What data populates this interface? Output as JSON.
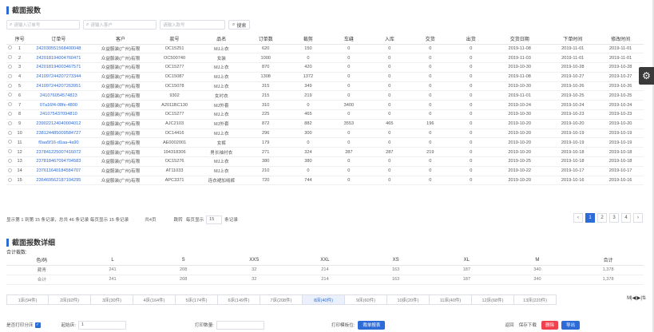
{
  "title": "截面报数",
  "search": {
    "order_placeholder": "请输入订单号",
    "customer_placeholder": "请输入客户",
    "product_placeholder": "请输入款号",
    "search_label": "搜索"
  },
  "main": {
    "columns": [
      "序号",
      "订单号",
      "客户",
      "款号",
      "品名",
      "订单数",
      "裁剪",
      "车缝",
      "入库",
      "交货",
      "出货",
      "交货日期",
      "下单时间",
      "修改时间"
    ],
    "rows": [
      [
        "1",
        "242030551568400048",
        "众益服装(广州)有限",
        "OC15251",
        "MJ上衣",
        "620",
        "150",
        "0",
        "0",
        "0",
        "0",
        "2019-11-08",
        "2019-11-01",
        "2019-11-01"
      ],
      [
        "2",
        "242018194004760471",
        "众益服装(广州)有限",
        "OC500740",
        "女装",
        "1000",
        "0",
        "0",
        "0",
        "0",
        "0",
        "2019-11-03",
        "2019-11-01",
        "2019-11-01"
      ],
      [
        "3",
        "242018194003467571",
        "众益服装(广州)有限",
        "OC15277",
        "MJ上衣",
        "870",
        "420",
        "0",
        "0",
        "0",
        "0",
        "2019-10-30",
        "2019-10-28",
        "2019-10-28"
      ],
      [
        "4",
        "241097244207273344",
        "众益服装(广州)有限",
        "OC15087",
        "MJ上衣",
        "1308",
        "1372",
        "0",
        "0",
        "0",
        "0",
        "2019-11-08",
        "2019-10-27",
        "2019-10-27"
      ],
      [
        "5",
        "241097244207263951",
        "众益服装(广州)有限",
        "OC15078",
        "MJ上衣",
        "315",
        "349",
        "0",
        "0",
        "0",
        "0",
        "2019-10-30",
        "2019-10-26",
        "2019-10-26"
      ],
      [
        "6",
        "241076054574823",
        "众益服装(广州)有限",
        "9302",
        "女衬衣",
        "215",
        "219",
        "0",
        "0",
        "0",
        "0",
        "2019-11-01",
        "2019-10-25",
        "2019-10-25"
      ],
      [
        "7",
        "07a16f4-08fe-4800",
        "众益服装(广州)有限",
        "A2011BC130",
        "MJ外套",
        "310",
        "0",
        "3400",
        "0",
        "0",
        "0",
        "2019-10-24",
        "2019-10-24",
        "2019-10-24"
      ],
      [
        "8",
        "241075437094810",
        "众益服装(广州)有限",
        "OC15277",
        "MJ上衣",
        "225",
        "465",
        "0",
        "0",
        "0",
        "0",
        "2019-10-30",
        "2019-10-23",
        "2019-10-23"
      ],
      [
        "9",
        "239022124040004012",
        "众益服装(广州)有限",
        "AJC2103",
        "MJ外套",
        "872",
        "882",
        "3553",
        "465",
        "196",
        "0",
        "2019-10-20",
        "2019-10-20",
        "2019-10-20"
      ],
      [
        "10",
        "238124485009584727",
        "众益服装(广州)有限",
        "OC14416",
        "MJ上衣",
        "296",
        "300",
        "0",
        "0",
        "0",
        "0",
        "2019-10-20",
        "2019-10-19",
        "2019-10-19"
      ],
      [
        "11",
        "f0aa5f16-d1aa-4a90",
        "众益服装(广州)有限",
        "AE0002001",
        "女裤",
        "179",
        "0",
        "0",
        "0",
        "0",
        "0",
        "2019-10-20",
        "2019-10-19",
        "2019-10-19"
      ],
      [
        "12",
        "237841225007416072",
        "众益服装(广州)有限",
        "194318306",
        "男长袖衬衣",
        "271",
        "324",
        "287",
        "287",
        "219",
        "0",
        "2019-10-20",
        "2019-10-18",
        "2019-10-18"
      ],
      [
        "13",
        "237818467094704583",
        "众益服装(广州)有限",
        "OC15276",
        "MJ上衣",
        "380",
        "380",
        "0",
        "0",
        "0",
        "0",
        "2019-10-25",
        "2019-10-18",
        "2019-10-18"
      ],
      [
        "14",
        "237611640184584707",
        "众益服装(广州)有限",
        "AT11033",
        "MJ上衣",
        "210",
        "0",
        "0",
        "0",
        "0",
        "0",
        "2019-10-22",
        "2019-10-17",
        "2019-10-17"
      ],
      [
        "15",
        "236469562187104295",
        "众益服装(广州)有限",
        "APC3371",
        "连衣裙加绒裤",
        "720",
        "744",
        "0",
        "0",
        "0",
        "0",
        "2019-10-20",
        "2019-10-16",
        "2019-10-16"
      ]
    ]
  },
  "footer": {
    "summary": "显示第 1 到第 15 条记录，总共 46 条记录 每页显示 15 条记录",
    "pages_label": "共4页",
    "jump_label": "跳转",
    "per_page_label": "每页显示",
    "per_page_value": "15",
    "per_page_unit": "条记录",
    "pages": [
      "‹",
      "1",
      "2",
      "3",
      "4",
      "›"
    ],
    "active_page": "1"
  },
  "detail": {
    "title": "截面报数详细",
    "subtitle": "合计裁数:",
    "columns": [
      "色/码",
      "L",
      "S",
      "XXS",
      "XXL",
      "XS",
      "XL",
      "M",
      "合计"
    ],
    "rows": [
      [
        "藏青",
        "241",
        "208",
        "32",
        "214",
        "163",
        "187",
        "340",
        "1,378"
      ],
      [
        "合计",
        "241",
        "208",
        "32",
        "214",
        "163",
        "187",
        "340",
        "1,378"
      ]
    ]
  },
  "tabs": [
    "1床(94件)",
    "2床(92件)",
    "3床(30件)",
    "4床(164件)",
    "5床(174件)",
    "6床(149件)",
    "7床(208件)",
    "8床(40件)",
    "9床(60件)",
    "10床(20件)",
    "11床(40件)",
    "12床(68件)",
    "13床(220件)"
  ],
  "active_tab": 7,
  "tab_tools": "M|◀|▶|⇅",
  "bottom": {
    "print_label": "是否打印分床",
    "start_label": "起始床:",
    "start_value": "1",
    "print_qty_label": "打印数量:",
    "print_pos_label": "打印模板位:",
    "print_btn": "裁单报表",
    "back_label": "返回",
    "save_label": "保存下载",
    "delete_btn": "删除",
    "export_btn": "导出"
  },
  "colors": {
    "accent": "#2d6bd6",
    "danger": "#f0414e"
  },
  "icons": {
    "settings": "gear-icon",
    "search": "search-icon"
  }
}
